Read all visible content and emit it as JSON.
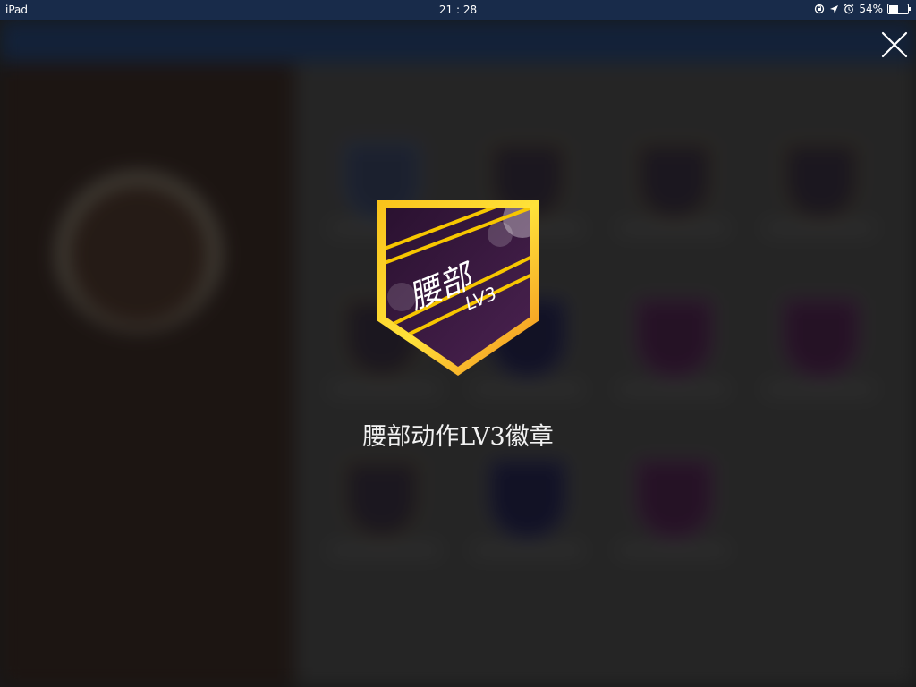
{
  "status_bar": {
    "device": "iPad",
    "time": "21 : 28",
    "battery_percent": "54%",
    "battery_level": 0.54,
    "icons": [
      "orientation-lock-icon",
      "location-icon",
      "alarm-icon",
      "battery-icon"
    ]
  },
  "modal": {
    "badge_main_text": "腰部",
    "badge_level_text": "LV3",
    "title": "腰部动作LV3徽章",
    "close_icon": "close-icon"
  },
  "colors": {
    "badge_border": "#f7a21b",
    "badge_fill": "#3b1b3f",
    "badge_stripe": "#f7c600"
  }
}
